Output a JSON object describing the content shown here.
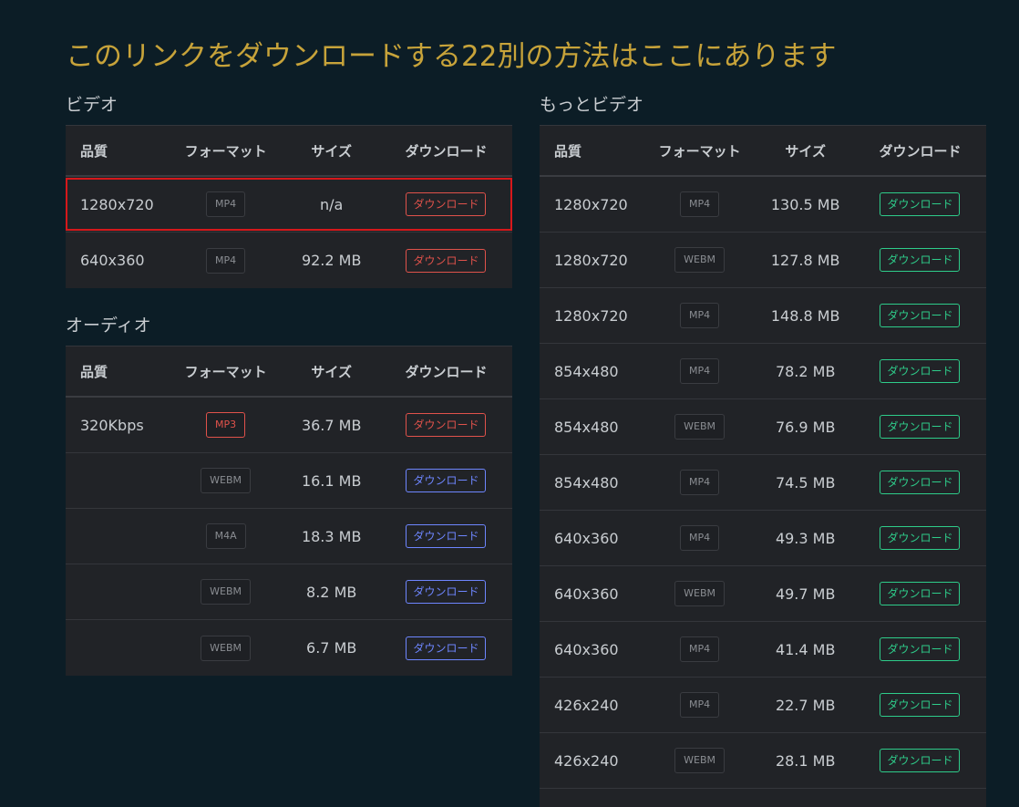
{
  "page": {
    "title": "このリンクをダウンロードする22別の方法はここにあります",
    "colors": {
      "background": "#0c1d26",
      "title": "#c7a33a",
      "table_bg": "#212327",
      "red": "#e0524b",
      "blue": "#6e86ff",
      "green": "#2ecc8a",
      "highlight": "#d6181b"
    }
  },
  "headers": {
    "quality": "品質",
    "format": "フォーマット",
    "size": "サイズ",
    "download": "ダウンロード"
  },
  "video": {
    "label": "ビデオ",
    "rows": [
      {
        "quality": "1280x720",
        "format": "MP4",
        "size": "n/a",
        "button": "ダウンロード"
      },
      {
        "quality": "640x360",
        "format": "MP4",
        "size": "92.2 MB",
        "button": "ダウンロード"
      }
    ]
  },
  "audio": {
    "label": "オーディオ",
    "rows": [
      {
        "quality": "320Kbps",
        "format": "MP3",
        "size": "36.7 MB",
        "button": "ダウンロード"
      },
      {
        "quality": "",
        "format": "WEBM",
        "size": "16.1 MB",
        "button": "ダウンロード"
      },
      {
        "quality": "",
        "format": "M4A",
        "size": "18.3 MB",
        "button": "ダウンロード"
      },
      {
        "quality": "",
        "format": "WEBM",
        "size": "8.2 MB",
        "button": "ダウンロード"
      },
      {
        "quality": "",
        "format": "WEBM",
        "size": "6.7 MB",
        "button": "ダウンロード"
      }
    ]
  },
  "more_video": {
    "label": "もっとビデオ",
    "rows": [
      {
        "quality": "1280x720",
        "format": "MP4",
        "size": "130.5 MB",
        "button": "ダウンロード"
      },
      {
        "quality": "1280x720",
        "format": "WEBM",
        "size": "127.8 MB",
        "button": "ダウンロード"
      },
      {
        "quality": "1280x720",
        "format": "MP4",
        "size": "148.8 MB",
        "button": "ダウンロード"
      },
      {
        "quality": "854x480",
        "format": "MP4",
        "size": "78.2 MB",
        "button": "ダウンロード"
      },
      {
        "quality": "854x480",
        "format": "WEBM",
        "size": "76.9 MB",
        "button": "ダウンロード"
      },
      {
        "quality": "854x480",
        "format": "MP4",
        "size": "74.5 MB",
        "button": "ダウンロード"
      },
      {
        "quality": "640x360",
        "format": "MP4",
        "size": "49.3 MB",
        "button": "ダウンロード"
      },
      {
        "quality": "640x360",
        "format": "WEBM",
        "size": "49.7 MB",
        "button": "ダウンロード"
      },
      {
        "quality": "640x360",
        "format": "MP4",
        "size": "41.4 MB",
        "button": "ダウンロード"
      },
      {
        "quality": "426x240",
        "format": "MP4",
        "size": "22.7 MB",
        "button": "ダウンロード"
      },
      {
        "quality": "426x240",
        "format": "WEBM",
        "size": "28.1 MB",
        "button": "ダウンロード"
      }
    ]
  }
}
